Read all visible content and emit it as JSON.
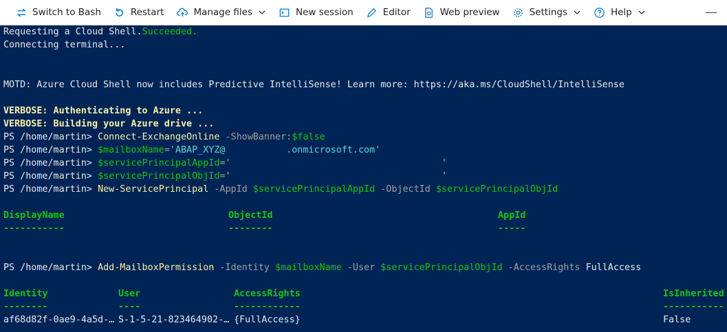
{
  "toolbar": {
    "switch_label": "Switch to Bash",
    "restart_label": "Restart",
    "manage_label": "Manage files",
    "new_session_label": "New session",
    "editor_label": "Editor",
    "web_preview_label": "Web preview",
    "settings_label": "Settings",
    "help_label": "Help"
  },
  "terminal": {
    "l1_a": "Requesting a Cloud Shell.",
    "l1_b": "Succeeded.",
    "l2": "Connecting terminal...",
    "motd": "MOTD: Azure Cloud Shell now includes Predictive IntelliSense! Learn more: https://aka.ms/CloudShell/IntelliSense",
    "verbose1": "VERBOSE: Authenticating to Azure ...",
    "verbose2": "VERBOSE: Building your Azure drive ...",
    "prompt": "PS /home/martin> ",
    "c1_cmd": "Connect-ExchangeOnline",
    "c1_param": " -ShowBanner:",
    "c1_val": "$false",
    "c2_var": "$mailboxName",
    "c2_eq": "=",
    "c2_str_a": "'ABAP_XYZ@",
    "c2_str_b": ".onmicrosoft.com'",
    "c3_var": "$servicePrincipalAppId",
    "c3_eq": "=",
    "c3_str_a": "'",
    "c3_str_b": "'",
    "c4_var": "$servicePrincipalObjId",
    "c4_eq": "=",
    "c4_str_a": "'",
    "c4_str_b": "'",
    "c5_cmd": "New-ServicePrincipal",
    "c5_p1": " -AppId ",
    "c5_v1": "$servicePrincipalAppId",
    "c5_p2": " -ObjectId ",
    "c5_v2": "$servicePrincipalObjId",
    "t1_headers": [
      "DisplayName",
      "ObjectId",
      "AppId"
    ],
    "t1_dashes": [
      "-----------",
      "--------",
      "-----"
    ],
    "c6_cmd": "Add-MailboxPermission",
    "c6_p1": " -Identity ",
    "c6_v1": "$mailboxName",
    "c6_p2": " -User ",
    "c6_v2": "$servicePrincipalObjId",
    "c6_p3": " -AccessRights ",
    "c6_v3": "FullAccess",
    "t2_headers": [
      "Identity",
      "User",
      "AccessRights",
      "IsInherited"
    ],
    "t2_dashes": [
      "--------",
      "----",
      "------------",
      "-----------"
    ],
    "t2_row": [
      "af68d82f-0ae9-4a5d-…",
      "S-1-5-21-823464902-…",
      "{FullAccess}",
      "False"
    ]
  }
}
